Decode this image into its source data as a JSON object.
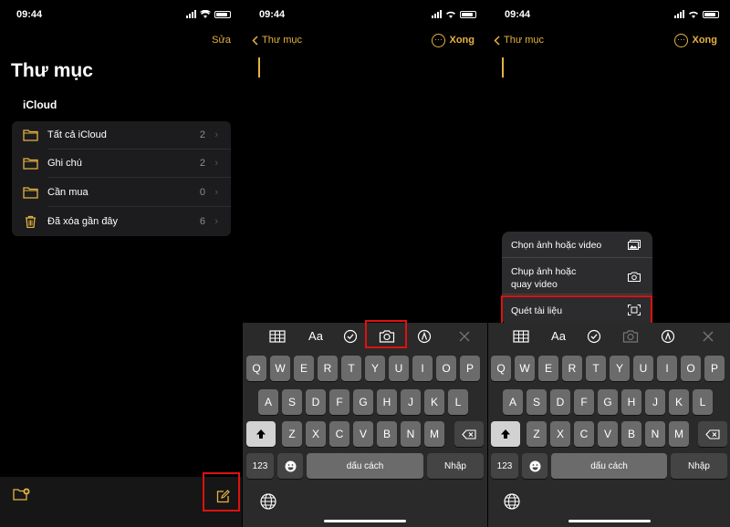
{
  "colors": {
    "accent": "#e6b341",
    "highlight": "#e01010",
    "background": "#000000"
  },
  "status": {
    "time": "09:44"
  },
  "screen1": {
    "edit_label": "Sửa",
    "title": "Thư mục",
    "section": "iCloud",
    "folders": [
      {
        "label": "Tất cả iCloud",
        "count": "2",
        "icon": "folder-icon"
      },
      {
        "label": "Ghi chú",
        "count": "2",
        "icon": "folder-icon"
      },
      {
        "label": "Cần mua",
        "count": "0",
        "icon": "folder-icon"
      },
      {
        "label": "Đã xóa gần đây",
        "count": "6",
        "icon": "trash-icon"
      }
    ],
    "bottom_icons": [
      "new-folder-icon",
      "compose-icon"
    ]
  },
  "editor": {
    "back_label": "Thư mục",
    "more_label": "···",
    "done_label": "Xong",
    "toolbar_icons": [
      "table-icon",
      "text-format-icon",
      "checklist-icon",
      "camera-icon",
      "markup-icon",
      "close-icon"
    ],
    "toolbar_text": "Aa"
  },
  "keyboard": {
    "row1": [
      "Q",
      "W",
      "E",
      "R",
      "T",
      "Y",
      "U",
      "I",
      "O",
      "P"
    ],
    "row2": [
      "A",
      "S",
      "D",
      "F",
      "G",
      "H",
      "J",
      "K",
      "L"
    ],
    "row3": [
      "Z",
      "X",
      "C",
      "V",
      "B",
      "N",
      "M"
    ],
    "numbers_label": "123",
    "space_label": "dấu cách",
    "return_label": "Nhập"
  },
  "camera_menu": {
    "items": [
      {
        "label": "Chọn ảnh hoặc video",
        "icon": "photo-library-icon"
      },
      {
        "label": "Chụp ảnh hoặc quay video",
        "line1": "Chụp ảnh hoặc",
        "line2": "quay video",
        "icon": "camera-icon"
      },
      {
        "label": "Quét tài liệu",
        "icon": "document-scan-icon"
      }
    ]
  }
}
